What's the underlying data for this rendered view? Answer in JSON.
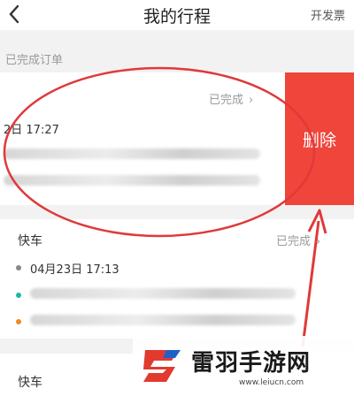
{
  "header": {
    "title": "我的行程",
    "invoice_label": "开发票"
  },
  "section": {
    "completed_label": "已完成订单"
  },
  "orders": [
    {
      "status": "已完成",
      "time": "2日 17:27"
    },
    {
      "type": "快车",
      "status": "已完成",
      "time": "04月23日 17:13"
    },
    {
      "type": "快车"
    }
  ],
  "swipe_action": {
    "delete_label": "删除"
  },
  "colors": {
    "delete_bg": "#f0453a",
    "annotation_red": "#e0393a",
    "pickup_dot": "#1fb7a6",
    "dropoff_dot": "#f08a24",
    "time_dot": "#888888"
  },
  "icons": {
    "back": "chevron-left-icon",
    "chevron": "chevron-right-icon"
  },
  "watermark": {
    "name": "雷羽手游网",
    "url": "www.leiucn.com"
  }
}
